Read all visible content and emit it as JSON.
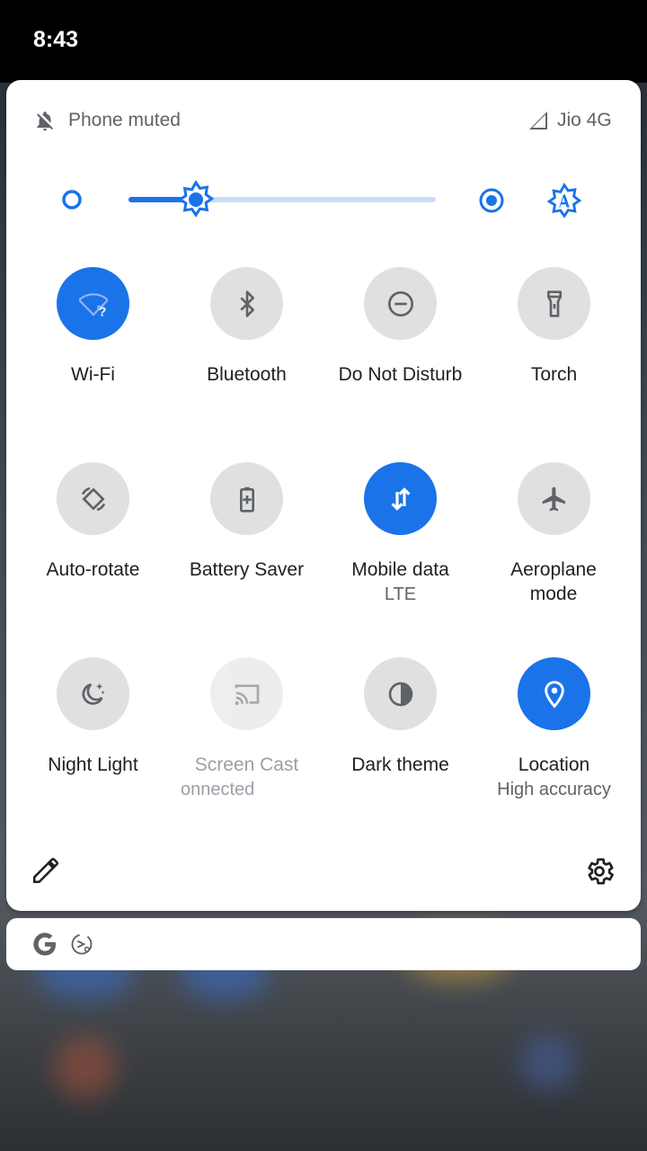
{
  "status_bar": {
    "time": "8:43"
  },
  "header": {
    "ringer_status": "Phone muted",
    "carrier": "Jio 4G"
  },
  "brightness": {
    "level_fraction": 0.22
  },
  "tiles": [
    {
      "label": "Wi-Fi",
      "sub": "",
      "icon": "wifi-unknown-icon",
      "state": "active"
    },
    {
      "label": "Bluetooth",
      "sub": "",
      "icon": "bluetooth-icon",
      "state": "inactive"
    },
    {
      "label": "Do Not Disturb",
      "sub": "",
      "icon": "do-not-disturb-icon",
      "state": "inactive"
    },
    {
      "label": "Torch",
      "sub": "",
      "icon": "torch-icon",
      "state": "inactive"
    },
    {
      "label": "Auto-rotate",
      "sub": "",
      "icon": "auto-rotate-icon",
      "state": "inactive"
    },
    {
      "label": "Battery Saver",
      "sub": "",
      "icon": "battery-saver-icon",
      "state": "inactive"
    },
    {
      "label": "Mobile data",
      "sub": "LTE",
      "icon": "mobile-data-icon",
      "state": "active"
    },
    {
      "label": "Aeroplane mode",
      "sub": "",
      "icon": "aeroplane-icon",
      "state": "inactive"
    },
    {
      "label": "Night Light",
      "sub": "",
      "icon": "night-light-icon",
      "state": "inactive"
    },
    {
      "label": "Screen Cast",
      "sub": "onnected",
      "icon": "cast-icon",
      "state": "disabled"
    },
    {
      "label": "Dark theme",
      "sub": "",
      "icon": "dark-theme-icon",
      "state": "inactive"
    },
    {
      "label": "Location",
      "sub": "High accuracy",
      "icon": "location-icon",
      "state": "active"
    }
  ],
  "colors": {
    "accent": "#1a73e8",
    "tile_inactive": "#e0e0e0",
    "icon_inactive": "#5f6368"
  }
}
